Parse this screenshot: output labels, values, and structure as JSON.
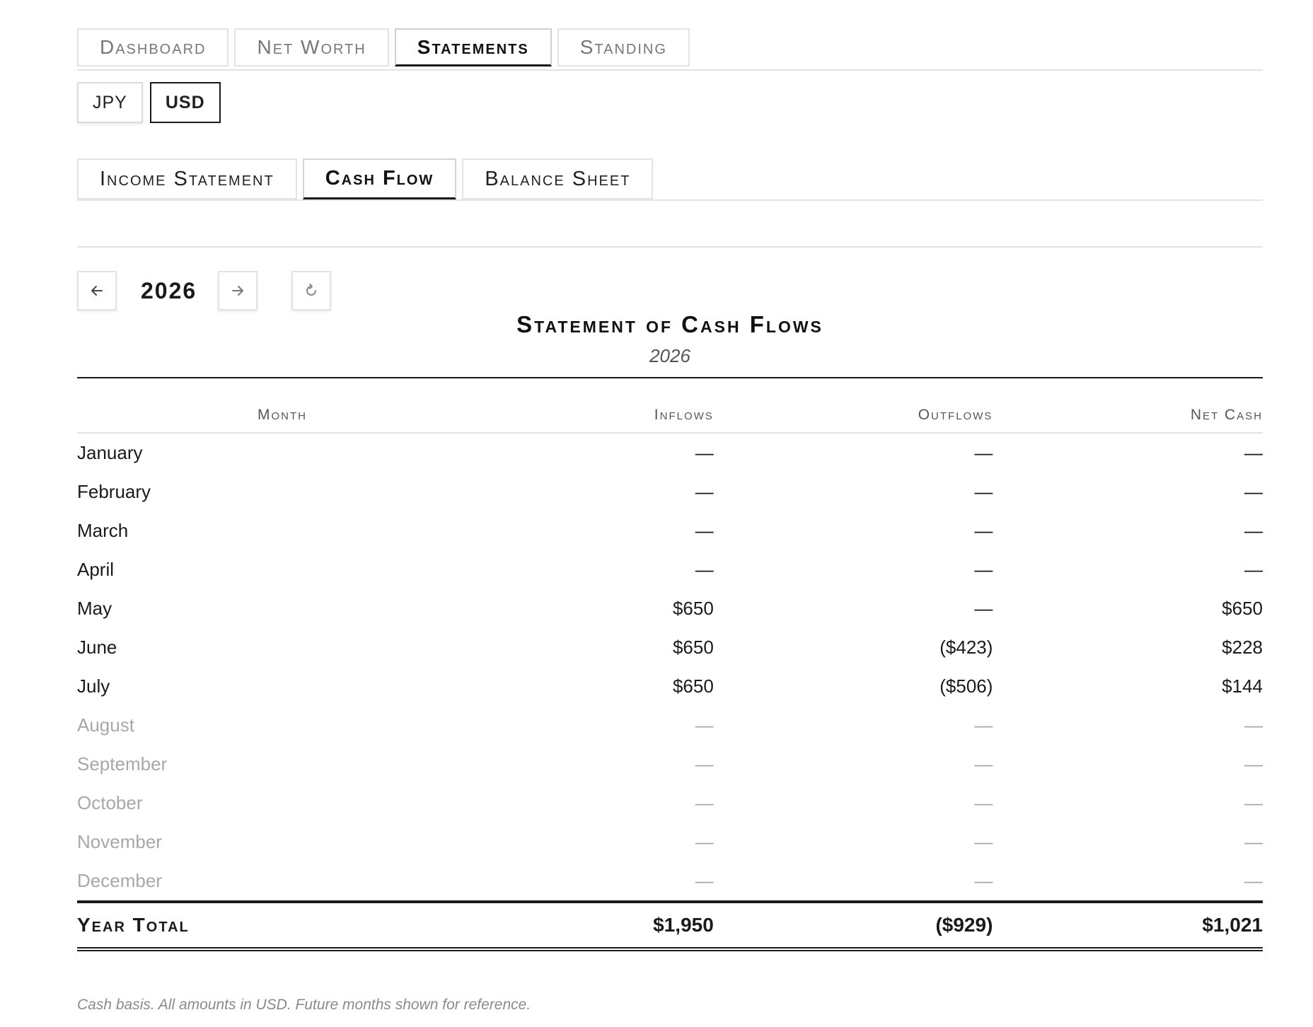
{
  "top_tabs": [
    {
      "label": "Dashboard",
      "active": false
    },
    {
      "label": "Net Worth",
      "active": false
    },
    {
      "label": "Statements",
      "active": true
    },
    {
      "label": "Standing",
      "active": false
    }
  ],
  "currency": {
    "options": [
      "JPY",
      "USD"
    ],
    "selected": "USD"
  },
  "sub_tabs": [
    {
      "label": "Income Statement",
      "active": false
    },
    {
      "label": "Cash Flow",
      "active": true
    },
    {
      "label": "Balance Sheet",
      "active": false
    }
  ],
  "year_nav": {
    "year": "2026",
    "prev_icon": "arrow-left-icon",
    "next_icon": "arrow-right-icon",
    "refresh_icon": "refresh-icon"
  },
  "statement": {
    "title": "Statement of Cash Flows",
    "subtitle": "2026"
  },
  "table": {
    "headers": {
      "month": "Month",
      "inflows": "Inflows",
      "outflows": "Outflows",
      "net": "Net Cash"
    },
    "rows": [
      {
        "month": "January",
        "inflows": "—",
        "outflows": "—",
        "net": "—",
        "future": false
      },
      {
        "month": "February",
        "inflows": "—",
        "outflows": "—",
        "net": "—",
        "future": false
      },
      {
        "month": "March",
        "inflows": "—",
        "outflows": "—",
        "net": "—",
        "future": false
      },
      {
        "month": "April",
        "inflows": "—",
        "outflows": "—",
        "net": "—",
        "future": false
      },
      {
        "month": "May",
        "inflows": "$650",
        "outflows": "—",
        "net": "$650",
        "future": false
      },
      {
        "month": "June",
        "inflows": "$650",
        "outflows": "($423)",
        "net": "$228",
        "future": false
      },
      {
        "month": "July",
        "inflows": "$650",
        "outflows": "($506)",
        "net": "$144",
        "future": false
      },
      {
        "month": "August",
        "inflows": "—",
        "outflows": "—",
        "net": "—",
        "future": true
      },
      {
        "month": "September",
        "inflows": "—",
        "outflows": "—",
        "net": "—",
        "future": true
      },
      {
        "month": "October",
        "inflows": "—",
        "outflows": "—",
        "net": "—",
        "future": true
      },
      {
        "month": "November",
        "inflows": "—",
        "outflows": "—",
        "net": "—",
        "future": true
      },
      {
        "month": "December",
        "inflows": "—",
        "outflows": "—",
        "net": "—",
        "future": true
      }
    ],
    "total": {
      "label": "Year Total",
      "inflows": "$1,950",
      "outflows": "($929)",
      "net": "$1,021"
    }
  },
  "footnote": "Cash basis. All amounts in USD. Future months shown for reference."
}
